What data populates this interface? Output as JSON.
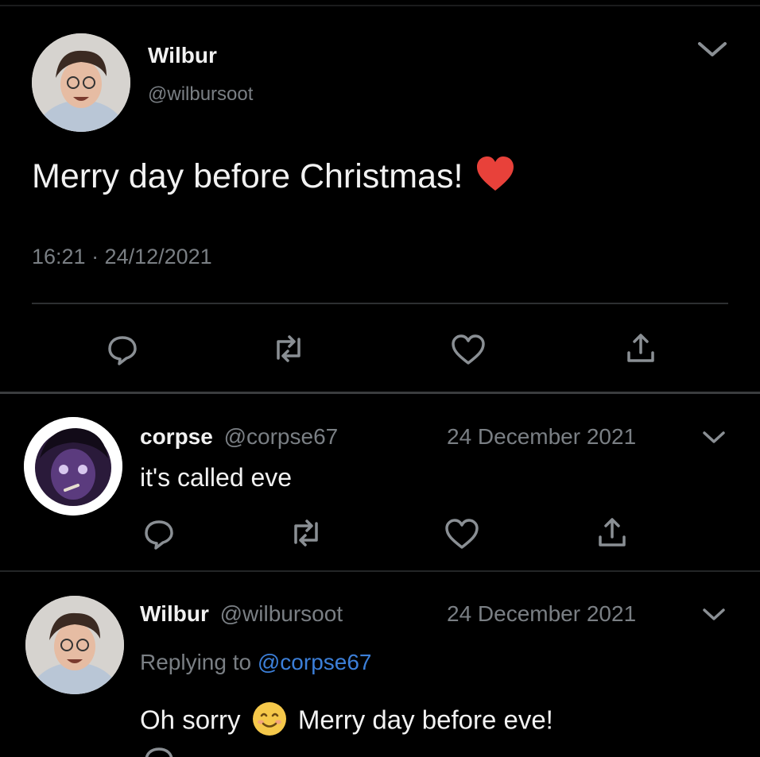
{
  "main_tweet": {
    "author_name": "Wilbur",
    "author_handle": "@wilbursoot",
    "text": "Merry day before Christmas!",
    "emoji": "❤",
    "timestamp": "16:21 · 24/12/2021"
  },
  "replies": [
    {
      "author_name": "corpse",
      "author_handle": "@corpse67",
      "date": "24 December 2021",
      "text": "it's called eve"
    },
    {
      "author_name": "Wilbur",
      "author_handle": "@wilbursoot",
      "date": "24 December 2021",
      "replying_label": "Replying to",
      "replying_handle": "@corpse67",
      "text_before": "Oh sorry",
      "emoji": "☺",
      "text_after": "Merry day before eve!"
    }
  ],
  "icons": [
    "reply-icon",
    "retweet-icon",
    "like-icon",
    "share-icon",
    "chevron-down-icon"
  ],
  "colors": {
    "background": "#000000",
    "link": "#3c7fd8",
    "heart": "#e8413a",
    "muted": "#7a7f84"
  }
}
